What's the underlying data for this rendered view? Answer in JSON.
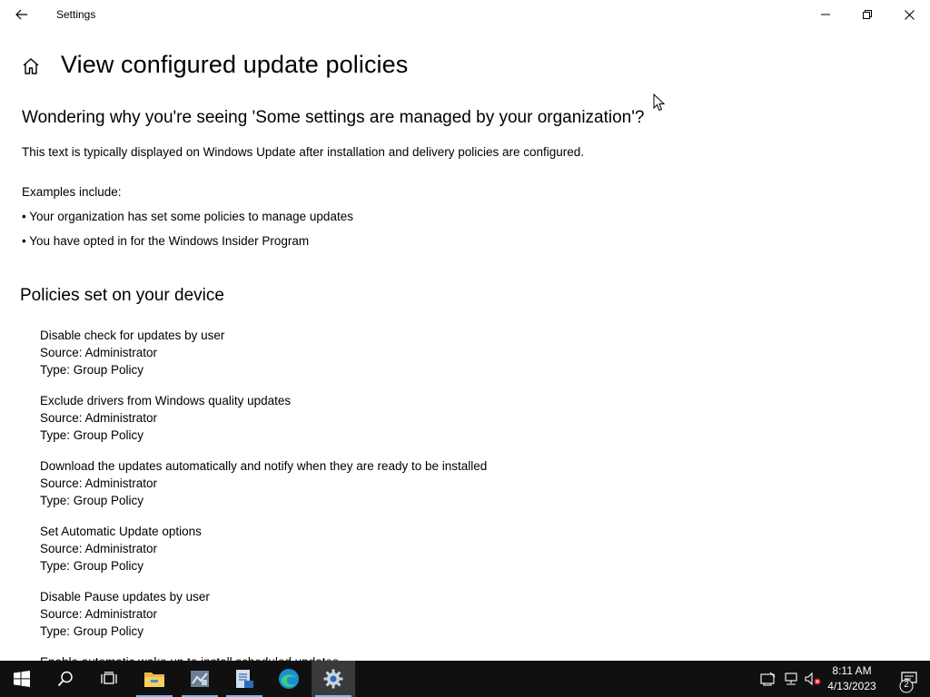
{
  "window": {
    "title": "Settings",
    "controls": {
      "minimize": "minimize-icon",
      "maximize": "restore-icon",
      "close": "close-icon"
    }
  },
  "page": {
    "title": "View configured update policies",
    "subheading": "Wondering why you're seeing 'Some settings are managed by your organization'?",
    "description": "This text is typically displayed on Windows Update after installation and delivery policies are configured.",
    "examples_label": "Examples include:",
    "examples": [
      "• Your organization has set some policies to manage updates",
      "• You have opted in for the Windows Insider Program"
    ]
  },
  "policies_section": {
    "title": "Policies set on your device",
    "items": [
      {
        "name": "Disable check for updates by user",
        "source": "Source: Administrator",
        "type": "Type: Group Policy"
      },
      {
        "name": "Exclude drivers from Windows quality updates",
        "source": "Source: Administrator",
        "type": "Type: Group Policy"
      },
      {
        "name": "Download the updates automatically and notify when they are ready to be installed",
        "source": "Source: Administrator",
        "type": "Type: Group Policy"
      },
      {
        "name": "Set Automatic Update options",
        "source": "Source: Administrator",
        "type": "Type: Group Policy"
      },
      {
        "name": "Disable Pause updates by user",
        "source": "Source: Administrator",
        "type": "Type: Group Policy"
      },
      {
        "name": "Enable automatic wake up to install scheduled updates"
      }
    ]
  },
  "taskbar": {
    "apps": [
      "windows-start-icon",
      "search-icon",
      "task-view-icon",
      "file-explorer-icon",
      "server-manager-icon",
      "notepad-file-icon",
      "edge-icon",
      "settings-gear-icon"
    ],
    "clock_time": "8:11 AM",
    "clock_date": "4/13/2023",
    "notification_count": "2",
    "accent_color": "#76b9ed"
  }
}
